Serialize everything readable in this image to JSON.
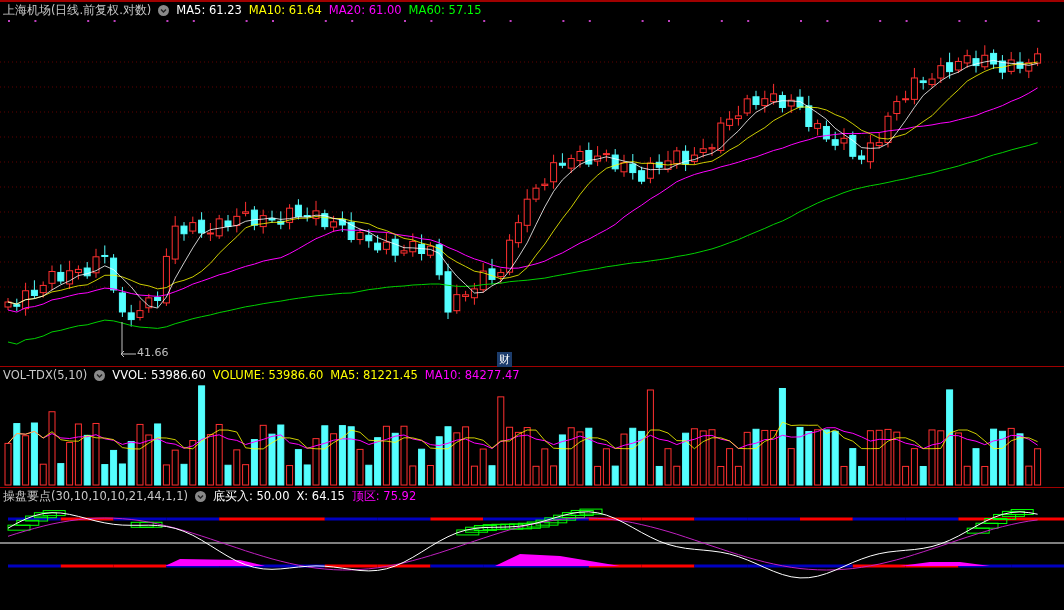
{
  "price_panel": {
    "title": "上海机场(日线.前复权.对数)",
    "indicators": [
      {
        "label": "MA5: 61.23",
        "color": "#ffffff"
      },
      {
        "label": "MA10: 61.64",
        "color": "#ffff00"
      },
      {
        "label": "MA20: 61.00",
        "color": "#ff00ff"
      },
      {
        "label": "MA60: 57.15",
        "color": "#00ff00"
      }
    ],
    "low_marker": "41.66",
    "finance_badge": "财"
  },
  "volume_panel": {
    "title": "VOL-TDX(5,10)",
    "indicators": [
      {
        "label": "VVOL: 53986.60",
        "color": "#ffffff"
      },
      {
        "label": "VOLUME: 53986.60",
        "color": "#ffff00"
      },
      {
        "label": "MA5: 81221.45",
        "color": "#ffff00"
      },
      {
        "label": "MA10: 84277.47",
        "color": "#ff00ff"
      }
    ]
  },
  "indicator_panel": {
    "title": "操盘要点(30,10,10,10,21,44,1,1)",
    "indicators": [
      {
        "label": "底买入: 50.00",
        "color": "#ffffff"
      },
      {
        "label": "X: 64.15",
        "color": "#ffffff"
      },
      {
        "label": "顶区: 75.92",
        "color": "#ff00ff"
      }
    ]
  }
}
